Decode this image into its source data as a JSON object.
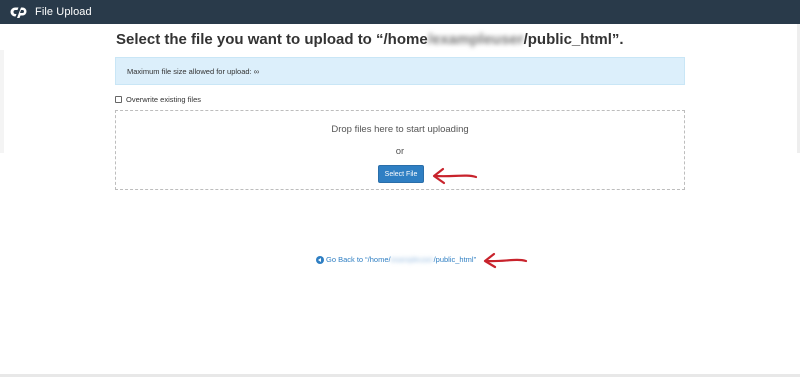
{
  "header": {
    "title": "File Upload",
    "logo_icon": "cpanel-logo-icon",
    "background": "#293a4a"
  },
  "main": {
    "heading_prefix": "Select the file you want to upload to “/home",
    "heading_blurred": "/exampleuser",
    "heading_suffix": "/public_html”.",
    "info_message": "Maximum file size allowed for upload: ∞",
    "overwrite_label": "Overwrite existing files",
    "overwrite_checked": false,
    "dropzone_text": "Drop files here to start uploading",
    "or_text": "or",
    "select_file_label": "Select File",
    "go_back_prefix": "Go Back to “/home/",
    "go_back_blurred": "exampleuser",
    "go_back_suffix": "/public_html”"
  },
  "colors": {
    "accent": "#2f7fc3",
    "info_bg": "#dceffb",
    "annotation_arrow": "#c8232c"
  }
}
